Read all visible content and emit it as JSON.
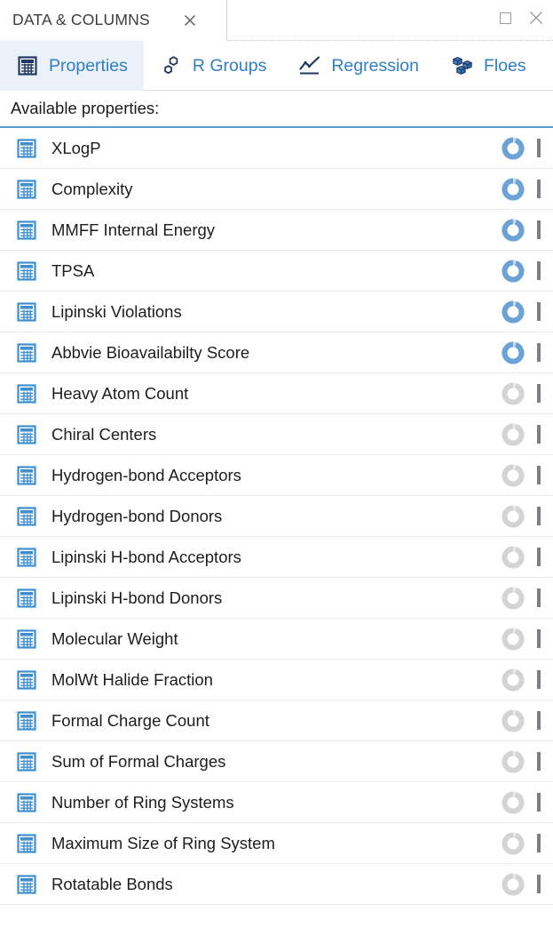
{
  "window": {
    "document_tab_title": "DATA & COLUMNS",
    "document_tab_close_icon": "close-icon",
    "document_tab_close_glyph": "✕",
    "maximize_icon": "maximize-icon",
    "close_icon": "close-icon",
    "close_glyph": "✕"
  },
  "tabs": [
    {
      "label": "Properties",
      "icon": "table-grid-icon",
      "active": true
    },
    {
      "label": "R Groups",
      "icon": "molecule-hexagon-icon",
      "active": false
    },
    {
      "label": "Regression",
      "icon": "trend-line-chart-icon",
      "active": false
    },
    {
      "label": "Floes",
      "icon": "stacked-cubes-icon",
      "active": false
    }
  ],
  "section": {
    "label": "Available properties:",
    "underline_color": "#5b9bd5"
  },
  "colors": {
    "tab_text": "#2f7fc4",
    "tab_active_bg": "#eaf1f8",
    "row_icon_blue": "#3f8fd0",
    "ring_active": "#6ba3d6",
    "ring_inactive": "#d4d4d4",
    "checkbox_border": "#7c7f86"
  },
  "properties": [
    {
      "name": "XLogP",
      "icon": "table-grid-icon",
      "ring_state": "active",
      "checked": false
    },
    {
      "name": "Complexity",
      "icon": "table-grid-icon",
      "ring_state": "active",
      "checked": false
    },
    {
      "name": "MMFF Internal Energy",
      "icon": "table-grid-icon",
      "ring_state": "active",
      "checked": false
    },
    {
      "name": "TPSA",
      "icon": "table-grid-icon",
      "ring_state": "active",
      "checked": false
    },
    {
      "name": "Lipinski Violations",
      "icon": "table-grid-icon",
      "ring_state": "active",
      "checked": false
    },
    {
      "name": "Abbvie Bioavailabilty Score",
      "icon": "table-grid-icon",
      "ring_state": "active",
      "checked": false
    },
    {
      "name": "Heavy Atom Count",
      "icon": "table-grid-icon",
      "ring_state": "inactive",
      "checked": false
    },
    {
      "name": "Chiral Centers",
      "icon": "table-grid-icon",
      "ring_state": "inactive",
      "checked": false
    },
    {
      "name": "Hydrogen-bond Acceptors",
      "icon": "table-grid-icon",
      "ring_state": "inactive",
      "checked": false
    },
    {
      "name": "Hydrogen-bond Donors",
      "icon": "table-grid-icon",
      "ring_state": "inactive",
      "checked": false
    },
    {
      "name": "Lipinski H-bond Acceptors",
      "icon": "table-grid-icon",
      "ring_state": "inactive",
      "checked": false
    },
    {
      "name": "Lipinski H-bond Donors",
      "icon": "table-grid-icon",
      "ring_state": "inactive",
      "checked": false
    },
    {
      "name": "Molecular Weight",
      "icon": "table-grid-icon",
      "ring_state": "inactive",
      "checked": false
    },
    {
      "name": "MolWt Halide Fraction",
      "icon": "table-grid-icon",
      "ring_state": "inactive",
      "checked": false
    },
    {
      "name": "Formal Charge Count",
      "icon": "table-grid-icon",
      "ring_state": "inactive",
      "checked": false
    },
    {
      "name": "Sum of Formal Charges",
      "icon": "table-grid-icon",
      "ring_state": "inactive",
      "checked": false
    },
    {
      "name": "Number of Ring Systems",
      "icon": "table-grid-icon",
      "ring_state": "inactive",
      "checked": false
    },
    {
      "name": "Maximum Size of Ring System",
      "icon": "table-grid-icon",
      "ring_state": "inactive",
      "checked": false
    },
    {
      "name": "Rotatable Bonds",
      "icon": "table-grid-icon",
      "ring_state": "inactive",
      "checked": false
    }
  ]
}
